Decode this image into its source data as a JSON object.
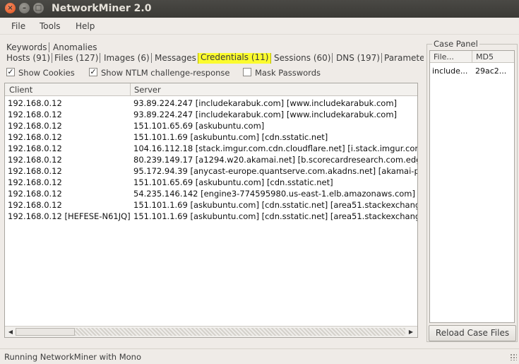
{
  "window": {
    "title": "NetworkMiner 2.0"
  },
  "menu": [
    "File",
    "Tools",
    "Help"
  ],
  "tabs_row1": [
    "Keywords",
    "Anomalies"
  ],
  "tabs_row2": [
    "Hosts (91)",
    "Files (127)",
    "Images (6)",
    "Messages",
    "Credentials (11)",
    "Sessions (60)",
    "DNS (197)",
    "Paramete"
  ],
  "active_tab": "Credentials (11)",
  "options": {
    "show_cookies": {
      "label": "Show Cookies",
      "checked": true
    },
    "show_ntlm": {
      "label": "Show NTLM challenge-response",
      "checked": true
    },
    "mask_passwords": {
      "label": "Mask Passwords",
      "checked": false
    }
  },
  "credentials": {
    "columns": [
      "Client",
      "Server"
    ],
    "rows": [
      [
        "192.168.0.12",
        "93.89.224.247 [includekarabuk.com] [www.includekarabuk.com]"
      ],
      [
        "192.168.0.12",
        "93.89.224.247 [includekarabuk.com] [www.includekarabuk.com]"
      ],
      [
        "192.168.0.12",
        "151.101.65.69 [askubuntu.com]"
      ],
      [
        "192.168.0.12",
        "151.101.1.69 [askubuntu.com] [cdn.sstatic.net]"
      ],
      [
        "192.168.0.12",
        "104.16.112.18 [stack.imgur.com.cdn.cloudflare.net] [i.stack.imgur.com"
      ],
      [
        "192.168.0.12",
        "80.239.149.17 [a1294.w20.akamai.net] [b.scorecardresearch.com.edg"
      ],
      [
        "192.168.0.12",
        "95.172.94.39 [anycast-europe.quantserve.com.akadns.net] [akamai-pi:"
      ],
      [
        "192.168.0.12",
        "151.101.65.69 [askubuntu.com] [cdn.sstatic.net]"
      ],
      [
        "192.168.0.12",
        "54.235.146.142 [engine3-774595980.us-east-1.elb.amazonaws.com] [e"
      ],
      [
        "192.168.0.12",
        "151.101.1.69 [askubuntu.com] [cdn.sstatic.net] [area51.stackexchange"
      ],
      [
        "192.168.0.12 [HEFESE-N61JQ]",
        "151.101.1.69 [askubuntu.com] [cdn.sstatic.net] [area51.stackexchange"
      ]
    ]
  },
  "case_panel": {
    "title": "Case Panel",
    "columns": [
      "File...",
      "MD5"
    ],
    "rows": [
      [
        "include...",
        "29ac2..."
      ]
    ],
    "reload_label": "Reload Case Files"
  },
  "status": "Running NetworkMiner with Mono",
  "colors": {
    "active_tab_highlight": "#fbfb2e",
    "titlebar": "#3b3a36",
    "close_button": "#e0531c"
  }
}
